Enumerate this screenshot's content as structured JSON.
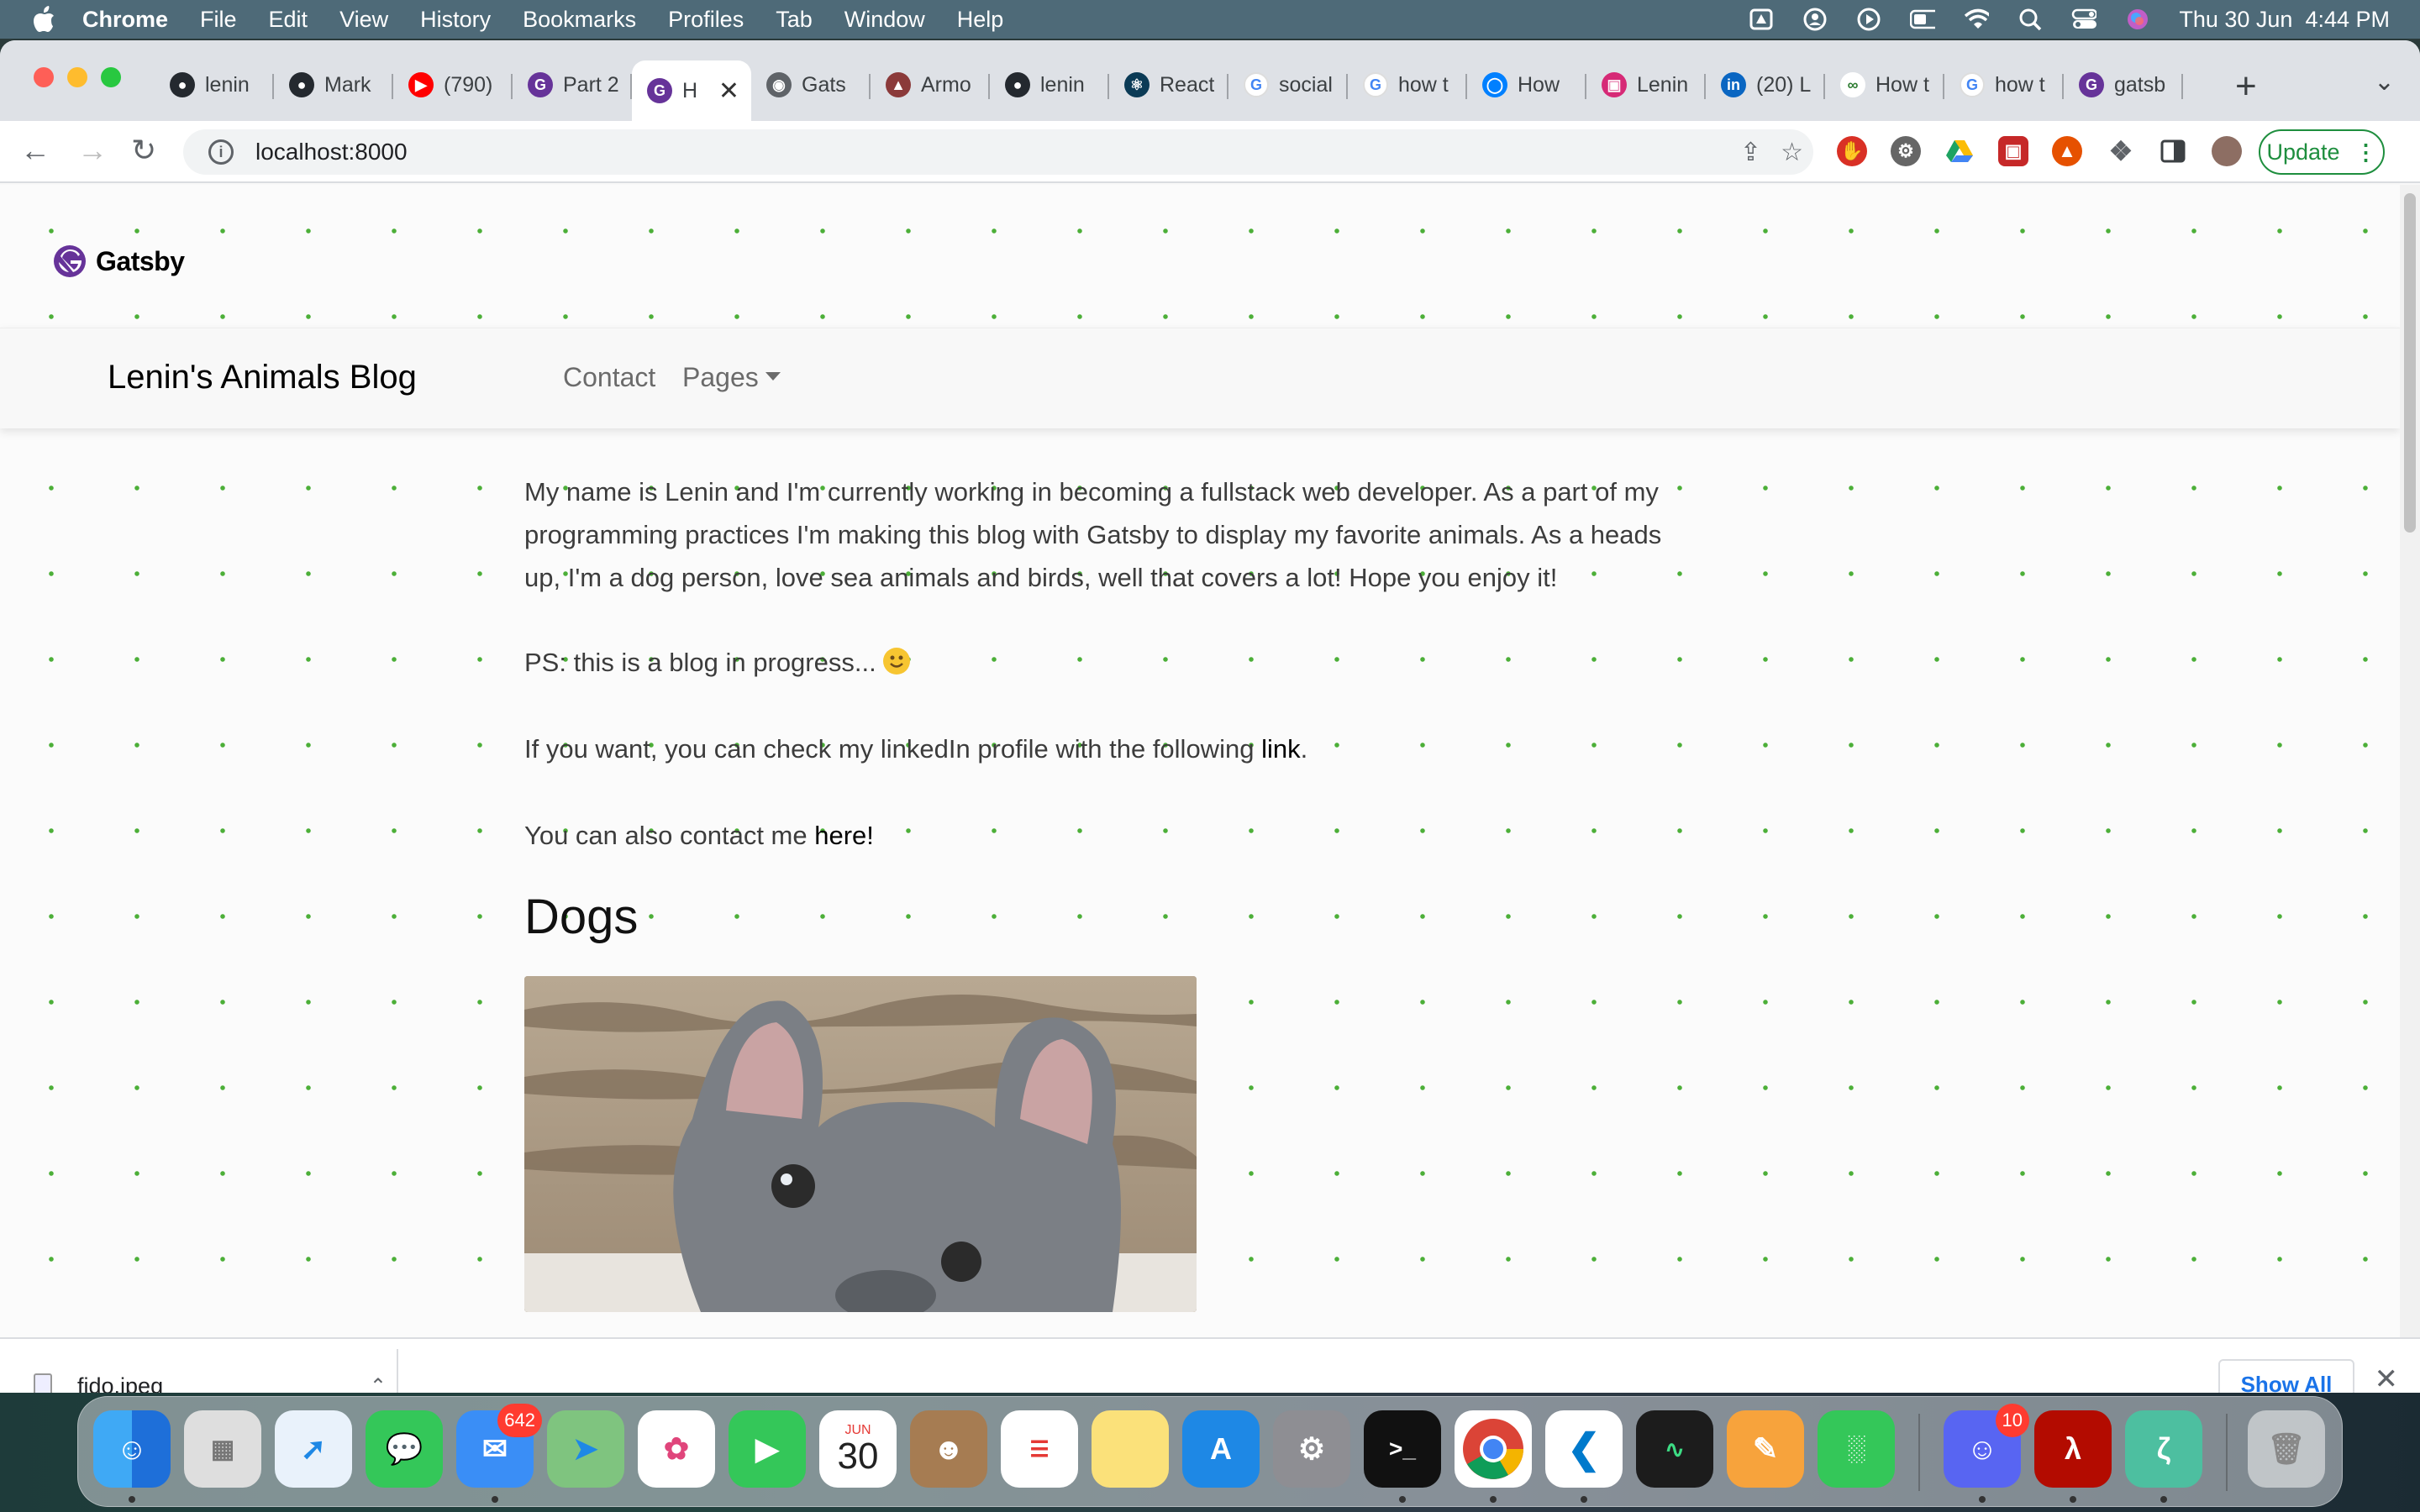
{
  "menubar": {
    "app": "Chrome",
    "items": [
      "File",
      "Edit",
      "View",
      "History",
      "Bookmarks",
      "Profiles",
      "Tab",
      "Window",
      "Help"
    ],
    "datetime": "Thu 30 Jun  4:44 PM"
  },
  "tabs": [
    {
      "title": "lenin",
      "icon": "github-icon"
    },
    {
      "title": "Mark",
      "icon": "github-icon"
    },
    {
      "title": "(790)",
      "icon": "youtube-icon"
    },
    {
      "title": "Part 2",
      "icon": "gatsby-icon"
    },
    {
      "title": "H",
      "icon": "gatsby-icon",
      "active": true
    },
    {
      "title": "Gats",
      "icon": "globe-icon"
    },
    {
      "title": "Armo",
      "icon": "armor-icon"
    },
    {
      "title": "lenin",
      "icon": "github-icon"
    },
    {
      "title": "React",
      "icon": "react-icon"
    },
    {
      "title": "social",
      "icon": "google-icon"
    },
    {
      "title": "how t",
      "icon": "google-icon"
    },
    {
      "title": "How",
      "icon": "digitalocean-icon"
    },
    {
      "title": "Lenin",
      "icon": "instagram-icon"
    },
    {
      "title": "(20) L",
      "icon": "linkedin-icon"
    },
    {
      "title": "How t",
      "icon": "link-icon"
    },
    {
      "title": "how t",
      "icon": "google-icon"
    },
    {
      "title": "gatsb",
      "icon": "gatsby-icon"
    }
  ],
  "toolbar": {
    "url": "localhost:8000",
    "update_label": "Update"
  },
  "page": {
    "logo_text": "Gatsby",
    "brand": "Lenin's Animals Blog",
    "nav": {
      "contact": "Contact",
      "pages": "Pages"
    },
    "intro": "My name is Lenin and I'm currently working in becoming a fullstack web developer. As a part of my programming practices I'm making this blog with Gatsby to display my favorite animals. As a heads up, I'm a dog person, love sea animals and birds, well that covers a lot! Hope you enjoy it!",
    "ps": "PS: this is a blog in progress...",
    "linkedin_prefix": "If you want, you can check my linkedIn profile with the following ",
    "linkedin_link": "link",
    "linkedin_suffix": ".",
    "contact_prefix": "You can also contact me ",
    "contact_link": "here!",
    "section_heading": "Dogs"
  },
  "downloads": {
    "file": "fido.jpeg",
    "show_all": "Show All"
  },
  "dock": {
    "mail_badge": "642",
    "calendar_month": "JUN",
    "calendar_day": "30",
    "discord_badge": "10"
  },
  "colors": {
    "dot_grid": "#4caf38",
    "gatsby_purple": "#663399",
    "update_green": "#1e8e3e"
  }
}
